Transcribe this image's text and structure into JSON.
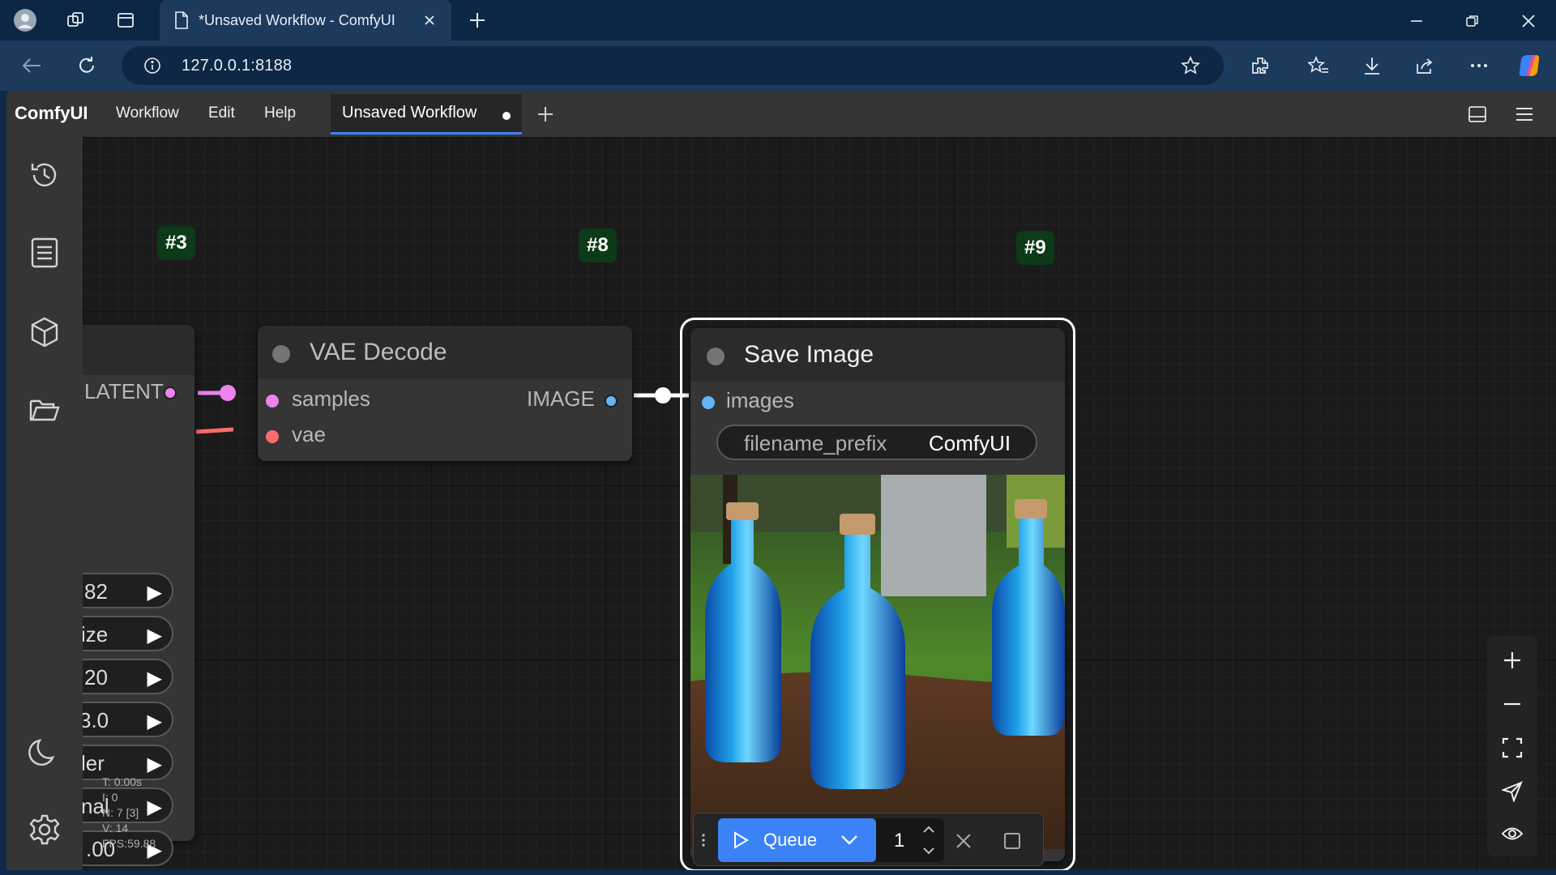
{
  "browser": {
    "tab_title": "*Unsaved Workflow - ComfyUI",
    "url": "127.0.0.1:8188"
  },
  "app": {
    "logo": "ComfyUI",
    "menu": [
      "Workflow",
      "Edit",
      "Help"
    ],
    "workflow_tab": "Unsaved Workflow",
    "accent_color": "#3b82f6"
  },
  "sidebar": {
    "items": [
      "history-icon",
      "queue-list-icon",
      "model-library-icon",
      "workflows-folder-icon",
      "theme-toggle-icon",
      "settings-icon"
    ]
  },
  "nodes": {
    "ksampler": {
      "badge": "#3",
      "output_label": "LATENT",
      "widgets": [
        "82",
        "ize",
        "20",
        "3.0",
        "ler",
        "nal",
        ".00"
      ]
    },
    "vae_decode": {
      "badge": "#8",
      "title": "VAE Decode",
      "inputs": [
        "samples",
        "vae"
      ],
      "output": "IMAGE"
    },
    "save_image": {
      "badge": "#9",
      "title": "Save Image",
      "input": "images",
      "widget_label": "filename_prefix",
      "widget_value": "ComfyUI"
    }
  },
  "stats": {
    "t": "T: 0.00s",
    "i": "I: 0",
    "n": "N: 7 [3]",
    "v": "V: 14",
    "fps": "FPS:59.88"
  },
  "queue": {
    "label": "Queue",
    "count": "1"
  },
  "colors": {
    "latent": "#ee82ee",
    "vae": "#ff6b6b",
    "image": "#64b5f6"
  }
}
